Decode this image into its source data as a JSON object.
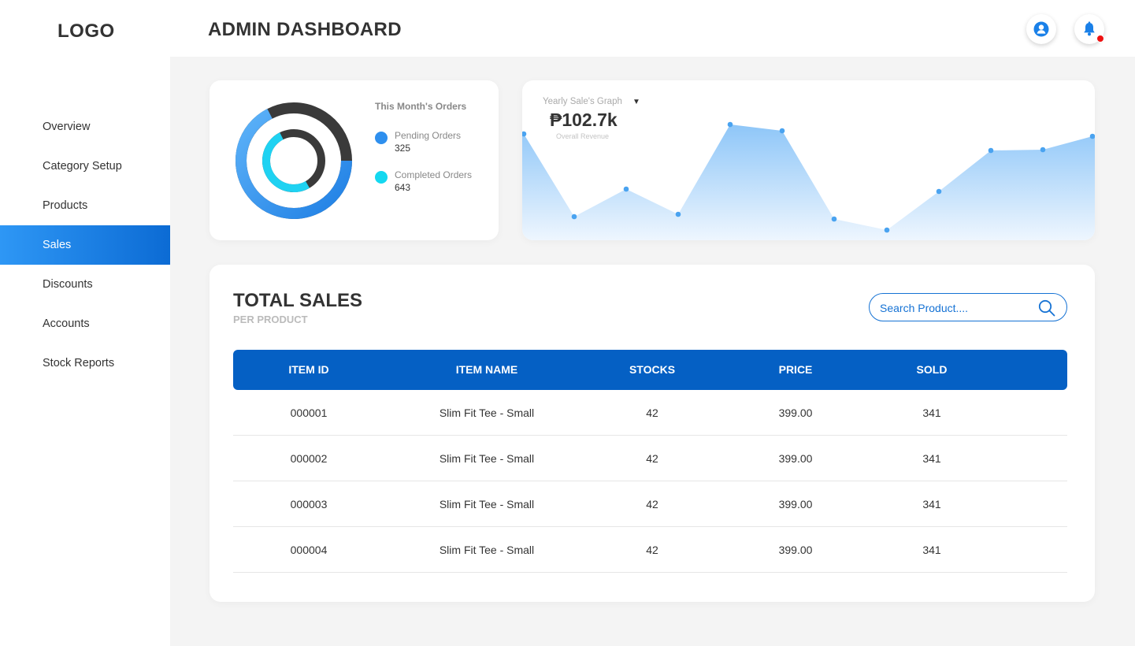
{
  "header": {
    "logo": "LOGO",
    "title": "ADMIN DASHBOARD",
    "profile_icon": "user-icon",
    "bell_icon": "bell-icon",
    "notification_color": "#ee1111"
  },
  "sidebar": {
    "items": [
      {
        "label": "Overview",
        "active": false
      },
      {
        "label": "Category Setup",
        "active": false
      },
      {
        "label": "Products",
        "active": false
      },
      {
        "label": "Sales",
        "active": true
      },
      {
        "label": "Discounts",
        "active": false
      },
      {
        "label": "Accounts",
        "active": false
      },
      {
        "label": "Stock Reports",
        "active": false
      }
    ]
  },
  "orders": {
    "title": "This Month's Orders",
    "pending": {
      "label": "Pending Orders",
      "value": "325",
      "color": "#2e8fee"
    },
    "completed": {
      "label": "Completed Orders",
      "value": "643",
      "color": "#14d8f0"
    }
  },
  "sales_graph": {
    "title": "Yearly Sale's Graph",
    "caret": "▼",
    "amount": "₱102.7k",
    "subtitle": "Overall Revenue"
  },
  "total_sales": {
    "title": "TOTAL SALES",
    "subtitle": "PER PRODUCT",
    "search_placeholder": "Search Product....",
    "search_icon": "search-icon",
    "columns": [
      "ITEM ID",
      "ITEM NAME",
      "STOCKS",
      "PRICE",
      "SOLD"
    ],
    "rows": [
      [
        "000001",
        "Slim Fit Tee - Small",
        "42",
        "399.00",
        "341"
      ],
      [
        "000002",
        "Slim Fit Tee - Small",
        "42",
        "399.00",
        "341"
      ],
      [
        "000003",
        "Slim Fit Tee - Small",
        "42",
        "399.00",
        "341"
      ],
      [
        "000004",
        "Slim Fit Tee - Small",
        "42",
        "399.00",
        "341"
      ]
    ]
  },
  "colors": {
    "accent": "#0560c4",
    "accent_light": "#2e97f5",
    "graph_fill": "#8ec6f8",
    "graph_point": "#4aa3f0"
  }
}
